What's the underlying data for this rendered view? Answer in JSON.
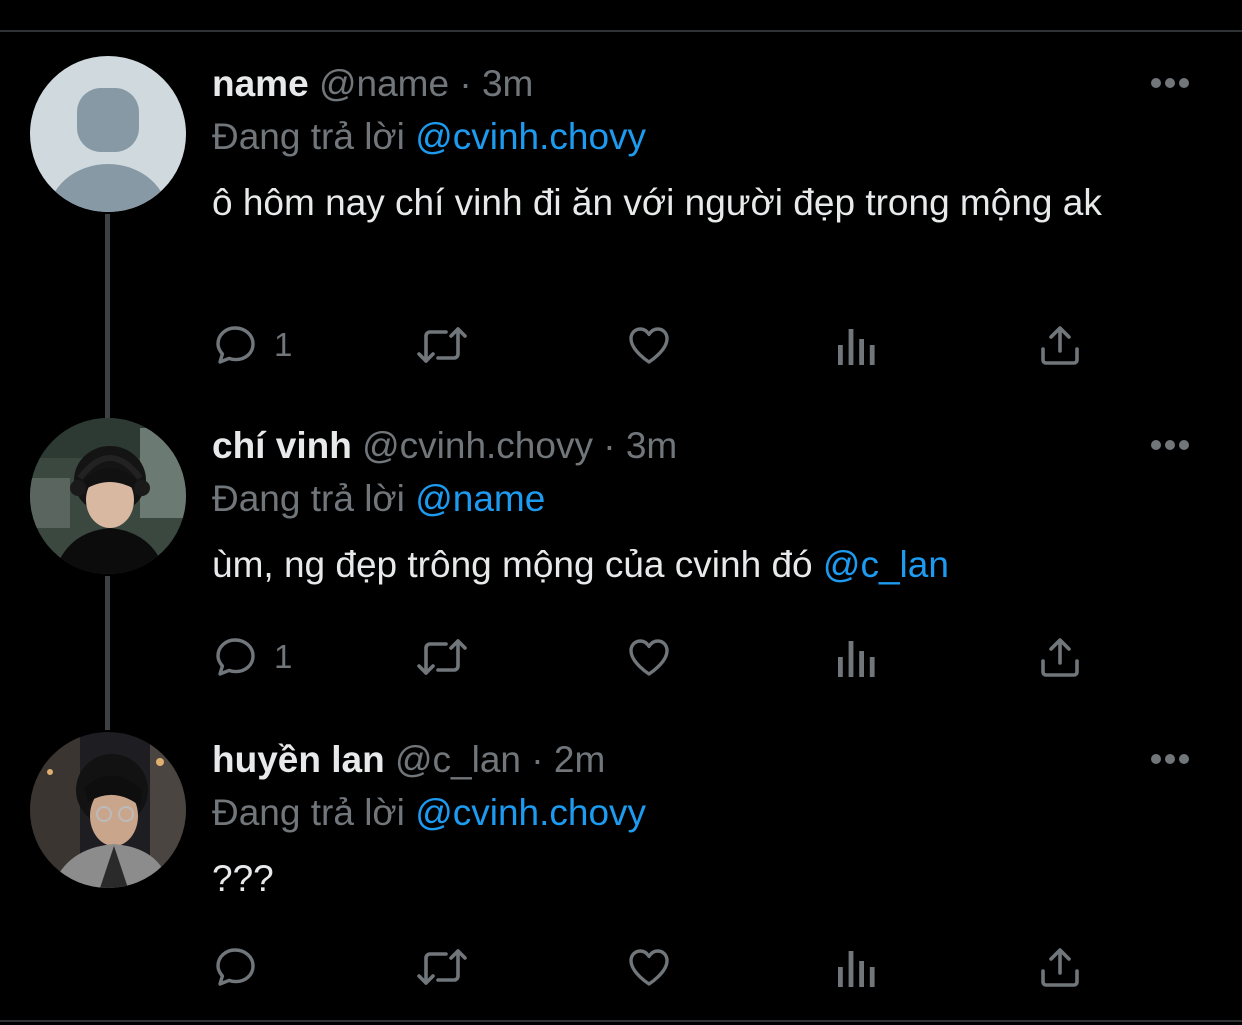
{
  "thread": {
    "tweets": [
      {
        "display_name": "name",
        "handle": "@name",
        "separator": "·",
        "time": "3m",
        "reply_prefix": "Đang trả lời",
        "reply_to": "@cvinh.chovy",
        "text": "ô hôm nay chí vinh đi ăn với người đẹp trong mộng ak",
        "text_mention": "",
        "reply_count": "1",
        "avatar": "default-profile-avatar"
      },
      {
        "display_name": "chí vinh",
        "handle": "@cvinh.chovy",
        "separator": "·",
        "time": "3m",
        "reply_prefix": "Đang trả lời",
        "reply_to": "@name",
        "text": "ùm, ng đẹp trông mộng của cvinh đó ",
        "text_mention": "@c_lan",
        "reply_count": "1",
        "avatar": "photo-avatar"
      },
      {
        "display_name": "huyền lan",
        "handle": "@c_lan",
        "separator": "·",
        "time": "2m",
        "reply_prefix": "Đang trả lời",
        "reply_to": "@cvinh.chovy",
        "text": "???",
        "text_mention": "",
        "reply_count": "",
        "avatar": "photo-avatar"
      }
    ]
  },
  "colors": {
    "background": "#000000",
    "primary_text": "#e7e9ea",
    "secondary_text": "#71767b",
    "accent": "#1d9bf0",
    "thread_line": "#3e4144",
    "divider": "#2f3336"
  },
  "icons": [
    "reply-icon",
    "retweet-icon",
    "like-icon",
    "views-icon",
    "share-icon",
    "more-icon"
  ]
}
